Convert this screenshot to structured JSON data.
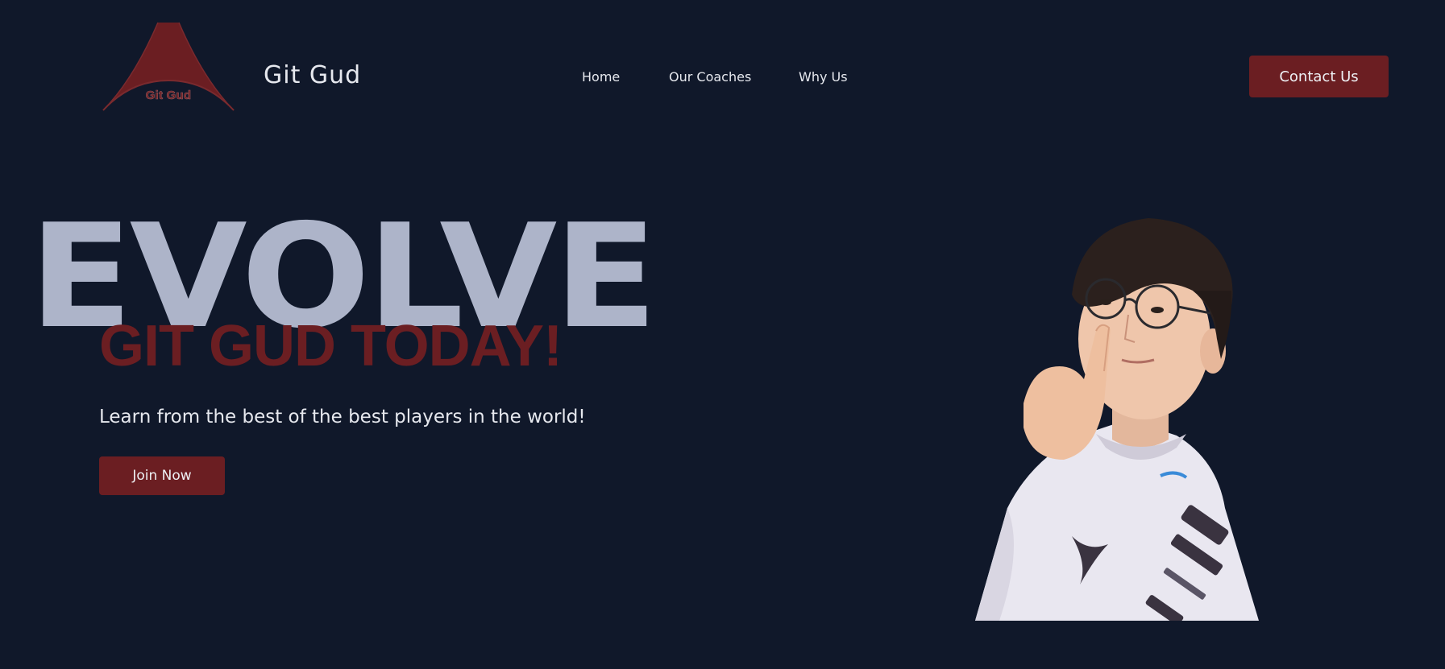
{
  "header": {
    "logo_text": "Git Gud",
    "brand_name": "Git Gud",
    "nav": [
      {
        "label": "Home"
      },
      {
        "label": "Our Coaches"
      },
      {
        "label": "Why Us"
      }
    ],
    "contact_label": "Contact Us"
  },
  "hero": {
    "background_word": "EVOLVE",
    "headline": "GIT GUD TODAY!",
    "tagline": "Learn from the best of the best players in the world!",
    "cta_label": "Join Now",
    "photo_icon": "player-photo"
  },
  "colors": {
    "background": "#10182a",
    "accent": "#6b1e22",
    "evolve_text": "#adb4c9",
    "text": "#e6e8ee"
  }
}
